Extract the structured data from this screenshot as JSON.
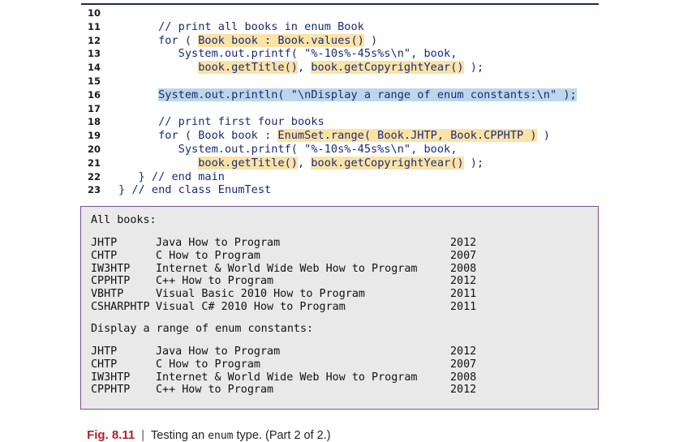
{
  "code_lines": [
    {
      "num": "10",
      "parts": []
    },
    {
      "num": "11",
      "parts": [
        {
          "t": "      // print all books in enum Book",
          "h": ""
        }
      ]
    },
    {
      "num": "12",
      "parts": [
        {
          "t": "      for ( ",
          "h": ""
        },
        {
          "t": "Book book : Book.values()",
          "h": "y"
        },
        {
          "t": " )",
          "h": ""
        }
      ]
    },
    {
      "num": "13",
      "parts": [
        {
          "t": "         System.out.printf( \"%-10s%-45s%s\\n\", book,",
          "h": ""
        }
      ]
    },
    {
      "num": "14",
      "parts": [
        {
          "t": "            ",
          "h": ""
        },
        {
          "t": "book.getTitle()",
          "h": "y"
        },
        {
          "t": ", ",
          "h": ""
        },
        {
          "t": "book.getCopyrightYear()",
          "h": "y"
        },
        {
          "t": " );",
          "h": ""
        }
      ]
    },
    {
      "num": "15",
      "parts": []
    },
    {
      "num": "16",
      "parts": [
        {
          "t": "      ",
          "h": ""
        },
        {
          "t": "System.out.println( \"\\nDisplay a range of enum constants:\\n\" );",
          "h": "b"
        }
      ]
    },
    {
      "num": "17",
      "parts": []
    },
    {
      "num": "18",
      "parts": [
        {
          "t": "      // print first four books",
          "h": ""
        }
      ]
    },
    {
      "num": "19",
      "parts": [
        {
          "t": "      for ( Book book : ",
          "h": ""
        },
        {
          "t": "EnumSet.range( Book.JHTP, Book.CPPHTP )",
          "h": "y"
        },
        {
          "t": " )",
          "h": ""
        }
      ]
    },
    {
      "num": "20",
      "parts": [
        {
          "t": "         System.out.printf( \"%-10s%-45s%s\\n\", book,",
          "h": ""
        }
      ]
    },
    {
      "num": "21",
      "parts": [
        {
          "t": "            ",
          "h": ""
        },
        {
          "t": "book.getTitle()",
          "h": "y"
        },
        {
          "t": ", ",
          "h": ""
        },
        {
          "t": "book.getCopyrightYear()",
          "h": "y"
        },
        {
          "t": " );",
          "h": ""
        }
      ]
    },
    {
      "num": "22",
      "parts": [
        {
          "t": "   } // end main",
          "h": ""
        }
      ]
    },
    {
      "num": "23",
      "parts": [
        {
          "t": "} // end class EnumTest",
          "h": ""
        }
      ]
    }
  ],
  "output": {
    "heading_all": "All books:",
    "all_books": [
      {
        "code": "JHTP",
        "title": "Java How to Program",
        "year": "2012"
      },
      {
        "code": "CHTP",
        "title": "C How to Program",
        "year": "2007"
      },
      {
        "code": "IW3HTP",
        "title": "Internet & World Wide Web How to Program",
        "year": "2008"
      },
      {
        "code": "CPPHTP",
        "title": "C++ How to Program",
        "year": "2012"
      },
      {
        "code": "VBHTP",
        "title": "Visual Basic 2010 How to Program",
        "year": "2011"
      },
      {
        "code": "CSHARPHTP",
        "title": "Visual C# 2010 How to Program",
        "year": "2011"
      }
    ],
    "heading_range": "Display a range of enum constants:",
    "range_books": [
      {
        "code": "JHTP",
        "title": "Java How to Program",
        "year": "2012"
      },
      {
        "code": "CHTP",
        "title": "C How to Program",
        "year": "2007"
      },
      {
        "code": "IW3HTP",
        "title": "Internet & World Wide Web How to Program",
        "year": "2008"
      },
      {
        "code": "CPPHTP",
        "title": "C++ How to Program",
        "year": "2012"
      }
    ]
  },
  "caption": {
    "label": "Fig. 8.11",
    "separator": "|",
    "text_before": "Testing an ",
    "code_word": "enum",
    "text_after": " type. (Part 2 of 2.)"
  }
}
